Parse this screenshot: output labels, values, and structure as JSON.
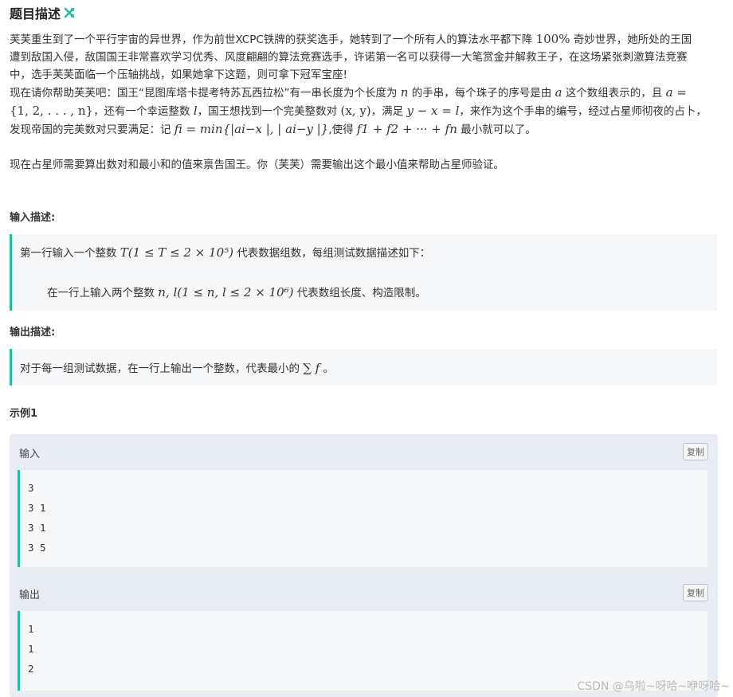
{
  "header": {
    "title": "题目描述"
  },
  "description": {
    "p1_a": "芙芙重生到了一个平行宇宙的异世界，作为前世XCPC铁牌的获奖选手，她转到了一个所有人的算法水平都下降",
    "p1_pct": "100%",
    "p1_b": "奇妙世界，她所处的王国",
    "p1_line2": "遭到敌国入侵，敌国国王非常喜欢学习优秀、风度翩翩的算法竞赛选手，许诺第一名可以获得一大笔赏金并解救王子，在这场紧张刺激算法竞赛",
    "p1_line3": "中，选手芙芙面临一个压轴挑战，如果她拿下这题，则可拿下冠军宝座!",
    "p2_a": "现在请你帮助芙芙吧：国王“昆图库塔卡提考特苏瓦西拉松”有一串长度为个长度为",
    "p2_n": "n",
    "p2_b": "的手串，每个珠子的序号是由",
    "p2_a_var": "a",
    "p2_c": "这个数组表示的，且",
    "p2_eq": "a =",
    "p3_set": "{1, 2, . . . , n}",
    "p3_a": "，还有一个幸运整数",
    "p3_l": "l",
    "p3_b": "，国王想找到一个完美整数对",
    "p3_pair": "(x, y)",
    "p3_c": "，满足",
    "p3_cond": "y − x = l",
    "p3_d": "，来作为这个手串的编号，经过占星师彻夜的占卜，",
    "p4_a": "发现帝国的完美数对只要满足：记",
    "p4_formula": "fi = min{|ai−x |, | ai−y |}",
    "p4_b": ",使得",
    "p4_sum": "f1 + f2 + ··· + fn",
    "p4_c": "最小就可以了。",
    "p5": "现在占星师需要算出数对和最小和的值来禀告国王。你（芙芙）需要输出这个最小值来帮助占星师验证。"
  },
  "input_section": {
    "label": "输入描述:",
    "line1_a": "第一行输入一个整数",
    "line1_math": "T(1 ≤ T ≤ 2 × 10⁵)",
    "line1_b": "代表数据组数，每组测试数据描述如下：",
    "line2_a": "在一行上输入两个整数",
    "line2_math": "n, l(1 ≤ n, l ≤ 2 × 10⁶)",
    "line2_b": "代表数组长度、构造限制。"
  },
  "output_section": {
    "label": "输出描述:",
    "line_a": "对于每一组测试数据，在一行上输出一个整数，代表最小的",
    "line_math": "∑ f",
    "line_b": "。"
  },
  "example": {
    "title": "示例1",
    "input_label": "输入",
    "output_label": "输出",
    "copy_label": "复制",
    "input_lines": [
      "3",
      "3 1",
      "3 1",
      "3 5"
    ],
    "output_lines": [
      "1",
      "1",
      "2"
    ]
  },
  "watermark": "CSDN @乌啦~呀哈~咿呀哈~",
  "colors": {
    "accent": "#25bb9b",
    "example_bg": "#e8edf3",
    "quote_bg": "#f6f7f9"
  }
}
